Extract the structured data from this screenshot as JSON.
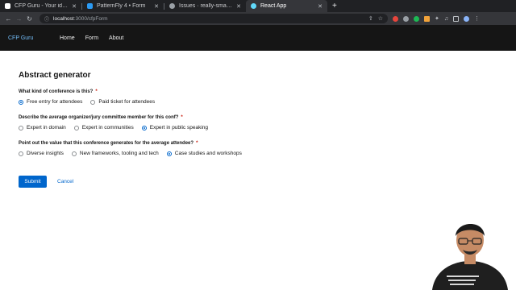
{
  "browser": {
    "tabs": [
      {
        "title": "CFP Guru - Your idea, ou",
        "color": "#ffffff",
        "active": false
      },
      {
        "title": "PatternFly 4 • Form",
        "color": "#2b9af3",
        "active": false
      },
      {
        "title": "Issues · really-smart-app",
        "color": "#9aa0a6",
        "active": false
      },
      {
        "title": "React App",
        "color": "#61dafb",
        "active": true
      }
    ],
    "new_tab_label": "+",
    "url_host": "localhost",
    "url_path": ":3000/cfpForm"
  },
  "app": {
    "brand": "CFP Guru",
    "nav": [
      "Home",
      "Form",
      "About"
    ]
  },
  "form": {
    "title": "Abstract generator",
    "questions": [
      {
        "label": "What kind of conference is this?",
        "required_mark": "*",
        "options": [
          "Free entry for attendees",
          "Paid ticket for attendees"
        ],
        "selected": 0
      },
      {
        "label": "Describe the average organizer/jury committee member for this conf?",
        "required_mark": "*",
        "options": [
          "Expert in domain",
          "Expert in communities",
          "Expert in public speaking"
        ],
        "selected": 2
      },
      {
        "label": "Point out the value that this conference generates for the average attendee?",
        "required_mark": "*",
        "options": [
          "Diverse insights",
          "New frameworks, tooling and tech",
          "Case studies and workshops"
        ],
        "selected": 2
      }
    ],
    "submit_label": "Submit",
    "cancel_label": "Cancel"
  },
  "colors": {
    "accent": "#0066cc",
    "header_bg": "#151515",
    "brand": "#73bcf7",
    "required": "#c9190b"
  }
}
